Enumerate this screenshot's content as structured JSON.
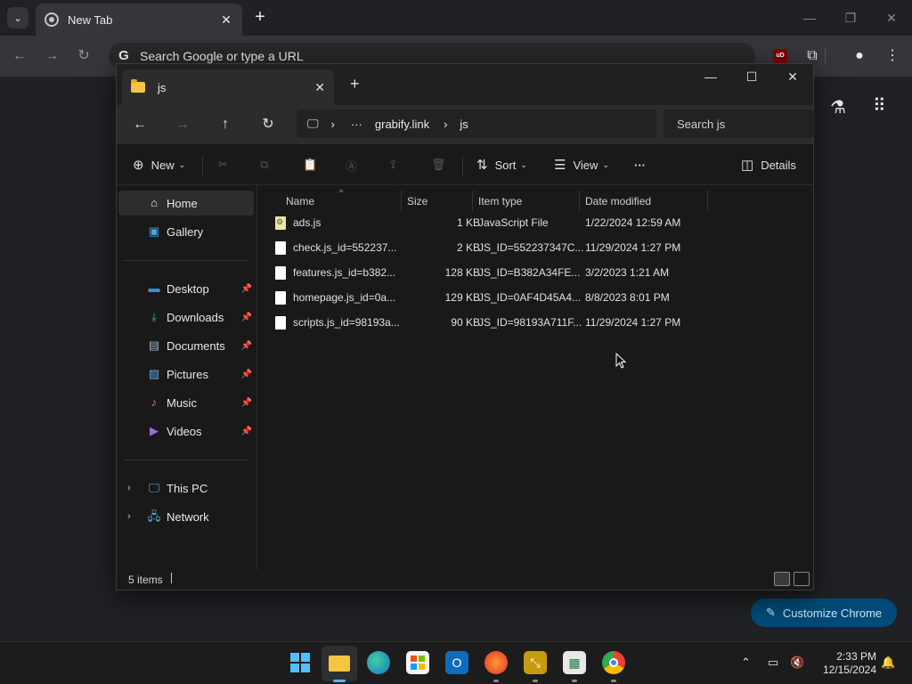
{
  "chrome": {
    "tab_title": "New Tab",
    "omnibox_placeholder": "Search Google or type a URL",
    "ublock_badge": "uD",
    "customize_label": "Customize Chrome"
  },
  "explorer": {
    "tab_title": "js",
    "breadcrumb": [
      "grabify.link",
      "js"
    ],
    "breadcrumb_more": "···",
    "search_placeholder": "Search js",
    "commands": {
      "new": "New",
      "sort": "Sort",
      "view": "View",
      "more": "···",
      "details": "Details"
    },
    "sidebar": {
      "home": "Home",
      "gallery": "Gallery",
      "quick_access": [
        {
          "label": "Desktop",
          "icon": "desktop-icon"
        },
        {
          "label": "Downloads",
          "icon": "download-icon"
        },
        {
          "label": "Documents",
          "icon": "document-icon"
        },
        {
          "label": "Pictures",
          "icon": "pictures-icon"
        },
        {
          "label": "Music",
          "icon": "music-icon"
        },
        {
          "label": "Videos",
          "icon": "videos-icon"
        }
      ],
      "this_pc": "This PC",
      "network": "Network"
    },
    "columns": {
      "name": "Name",
      "size": "Size",
      "type": "Item type",
      "modified": "Date modified"
    },
    "files": [
      {
        "name": "ads.js",
        "size": "1 KB",
        "type": "JavaScript File",
        "modified": "1/22/2024 12:59 AM"
      },
      {
        "name": "check.js_id=552237...",
        "size": "2 KB",
        "type": "JS_ID=552237347C...",
        "modified": "11/29/2024 1:27 PM"
      },
      {
        "name": "features.js_id=b382...",
        "size": "128 KB",
        "type": "JS_ID=B382A34FE...",
        "modified": "3/2/2023 1:21 AM"
      },
      {
        "name": "homepage.js_id=0a...",
        "size": "129 KB",
        "type": "JS_ID=0AF4D45A4...",
        "modified": "8/8/2023 8:01 PM"
      },
      {
        "name": "scripts.js_id=98193a...",
        "size": "90 KB",
        "type": "JS_ID=98193A711F...",
        "modified": "11/29/2024 1:27 PM"
      }
    ],
    "status": "5 items"
  },
  "taskbar": {
    "time": "2:33 PM",
    "date": "12/15/2024"
  },
  "colors": {
    "accent": "#5fb2f2",
    "customize_bg": "#004a77",
    "folder": "#f5c542"
  }
}
